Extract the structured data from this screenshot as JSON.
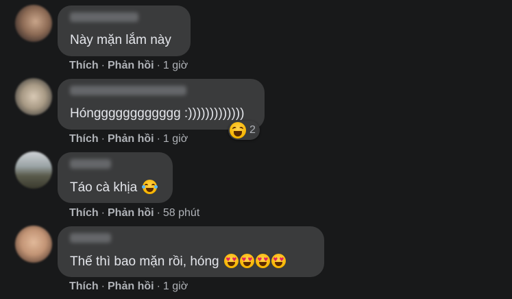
{
  "comments": [
    {
      "text": "Này mặn lắm này",
      "actions": {
        "like": "Thích",
        "reply": "Phản hồi",
        "time": "1 giờ"
      }
    },
    {
      "text": "Hóngggggggggggg :)))))))))))))",
      "reaction": {
        "icon": "laughing-squint-emoji-icon",
        "count": "2"
      },
      "actions": {
        "like": "Thích",
        "reply": "Phản hồi",
        "time": "1 giờ"
      }
    },
    {
      "text": "Táo cà khịa",
      "emoji": "tears-of-joy-emoji-icon",
      "actions": {
        "like": "Thích",
        "reply": "Phản hồi",
        "time": "58 phút"
      }
    },
    {
      "text": "Thế thì bao mặn rồi, hóng",
      "emoji": "heart-eyes-emoji-icon x4",
      "actions": {
        "like": "Thích",
        "reply": "Phản hồi",
        "time": "1 giờ"
      }
    }
  ],
  "colors": {
    "background": "#18191a",
    "bubble": "#3a3b3c",
    "text": "#e4e6eb",
    "secondary_text": "#b0b3b8"
  }
}
